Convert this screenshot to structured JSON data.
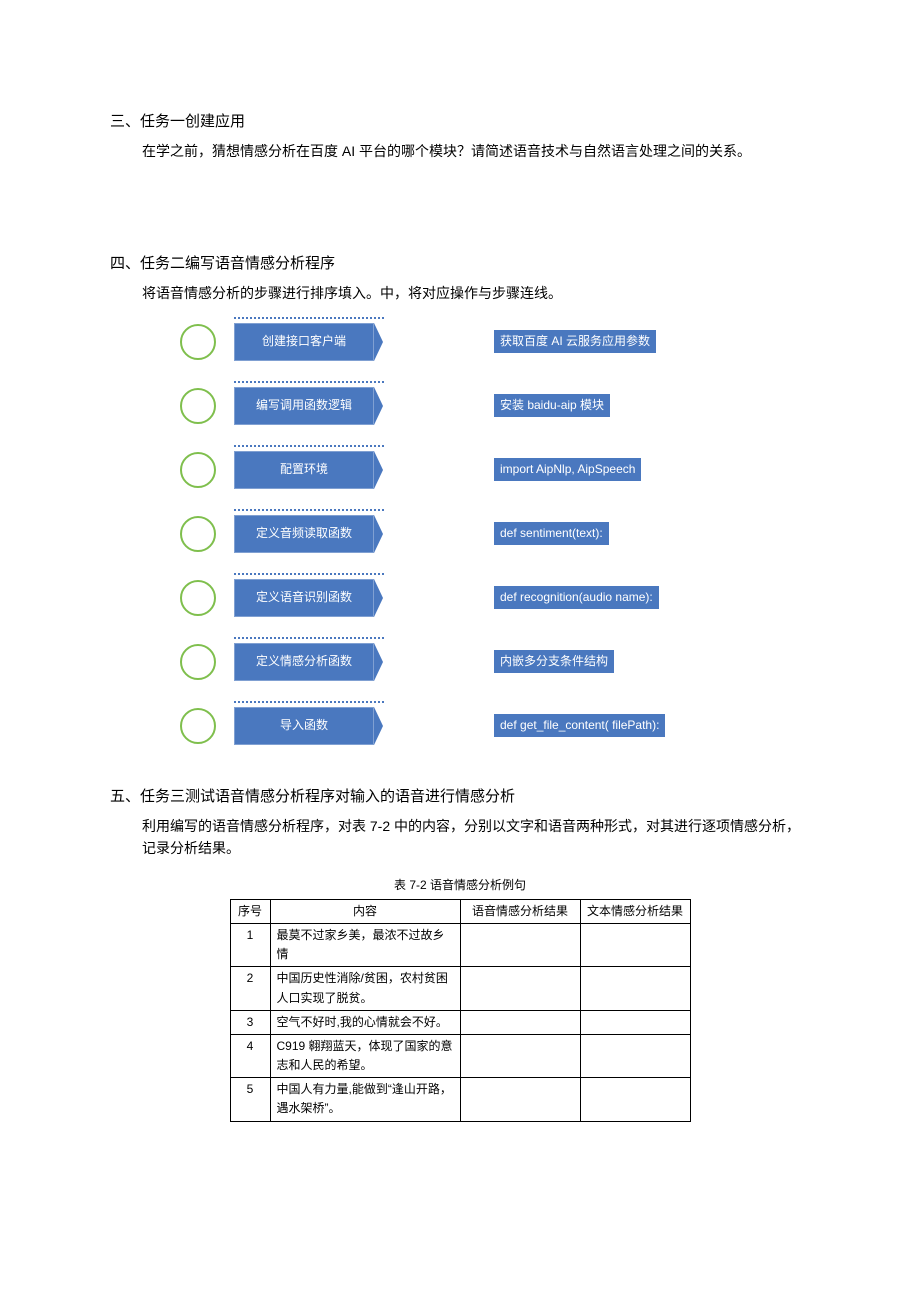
{
  "section3": {
    "heading": "三、任务一创建应用",
    "body": "在学之前，猜想情感分析在百度 AI 平台的哪个模块？请简述语音技术与自然语言处理之间的关系。"
  },
  "section4": {
    "heading": "四、任务二编写语音情感分析程序",
    "body": "将语音情感分析的步骤进行排序填入。中，将对应操作与步骤连线。",
    "matches": [
      {
        "left": "创建接口客户端",
        "right": "获取百度 AI 云服务应用参数"
      },
      {
        "left": "编写调用函数逻辑",
        "right": "安装 baidu-aip 模块"
      },
      {
        "left": "配置环境",
        "right": "import AipNlp, AipSpeech"
      },
      {
        "left": "定义音频读取函数",
        "right": "def sentiment(text):"
      },
      {
        "left": "定义语音识别函数",
        "right": "def recognition(audio name):"
      },
      {
        "left": "定义情感分析函数",
        "right": "内嵌多分支条件结构"
      },
      {
        "left": "导入函数",
        "right": "def get_file_content( filePath):"
      }
    ]
  },
  "section5": {
    "heading": "五、任务三测试语音情感分析程序对输入的语音进行情感分析",
    "body": "利用编写的语音情感分析程序，对表 7-2 中的内容，分别以文字和语音两种形式，对其进行逐项情感分析，记录分析结果。",
    "tableCaption": "表 7-2 语音情感分析例句",
    "tableHeaders": {
      "seq": "序号",
      "content": "内容",
      "voice": "语音情感分析结果",
      "text": "文本情感分析结果"
    },
    "rows": [
      {
        "seq": "1",
        "content": "最莫不过家乡美，最浓不过故乡情",
        "voice": "",
        "text": ""
      },
      {
        "seq": "2",
        "content": "中国历史性消除/贫困，农村贫困人口实现了脱贫。",
        "voice": "",
        "text": ""
      },
      {
        "seq": "3",
        "content": "空气不好时,我的心情就会不好。",
        "voice": "",
        "text": ""
      },
      {
        "seq": "4",
        "content": "C919 翱翔蓝天，体现了国家的意志和人民的希望。",
        "voice": "",
        "text": ""
      },
      {
        "seq": "5",
        "content": "中国人有力量,能做到“逢山开路，遇水架桥”。",
        "voice": "",
        "text": ""
      }
    ]
  }
}
